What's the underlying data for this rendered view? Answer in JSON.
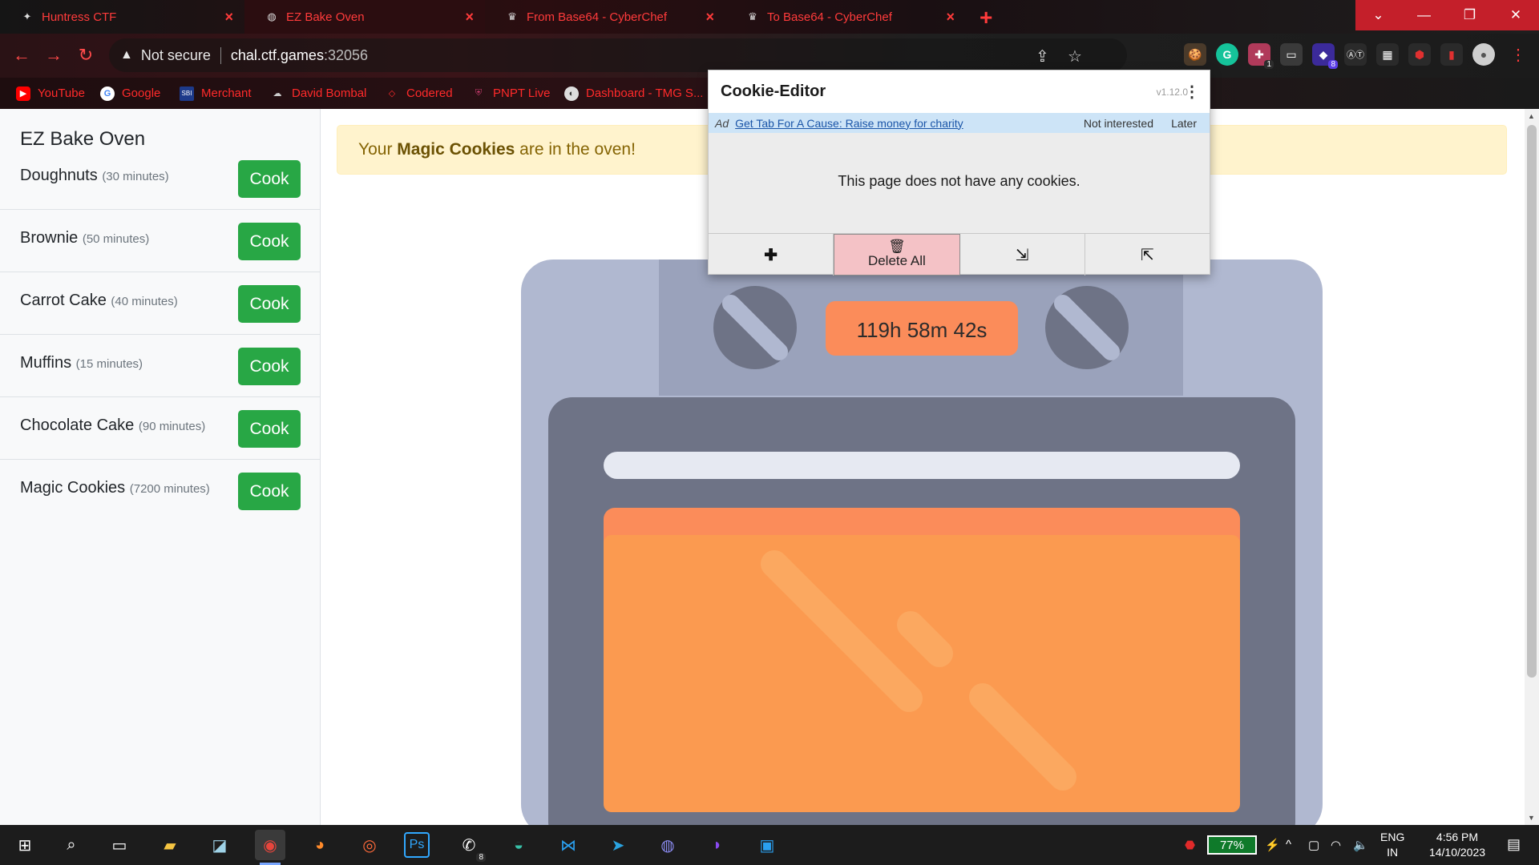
{
  "browser": {
    "tabs": [
      {
        "label": "Huntress CTF",
        "icon": "huntress-icon"
      },
      {
        "label": "EZ Bake Oven",
        "icon": "globe-icon"
      },
      {
        "label": "From Base64 - CyberChef",
        "icon": "chef-hat-icon"
      },
      {
        "label": "To Base64 - CyberChef",
        "icon": "chef-hat-icon"
      }
    ],
    "security_label": "Not secure",
    "url_host": "chal.ctf.games",
    "url_port": ":32056",
    "extension_badges": {
      "ext1": "1",
      "ext2": "8"
    },
    "bookmarks": [
      {
        "label": "YouTube",
        "icon": "youtube-icon",
        "color": "#ff0000"
      },
      {
        "label": "Google",
        "icon": "google-icon",
        "color": "#ffffff"
      },
      {
        "label": "Merchant",
        "icon": "merchant-icon",
        "color": "#1d3a8a"
      },
      {
        "label": "David Bombal",
        "icon": "david-bombal-icon",
        "color": "#cccccc"
      },
      {
        "label": "Codered",
        "icon": "codered-icon",
        "color": "#ff2a2a"
      },
      {
        "label": "PNPT Live",
        "icon": "pnpt-icon",
        "color": "#c23a6a"
      },
      {
        "label": "Dashboard - TMG S...",
        "icon": "dashboard-icon",
        "color": "#cccccc"
      }
    ]
  },
  "app": {
    "title": "EZ Bake Oven",
    "items": [
      {
        "name": "Doughnuts",
        "minutes": "(30 minutes)",
        "button": "Cook"
      },
      {
        "name": "Brownie",
        "minutes": "(50 minutes)",
        "button": "Cook"
      },
      {
        "name": "Carrot Cake",
        "minutes": "(40 minutes)",
        "button": "Cook"
      },
      {
        "name": "Muffins",
        "minutes": "(15 minutes)",
        "button": "Cook"
      },
      {
        "name": "Chocolate Cake",
        "minutes": "(90 minutes)",
        "button": "Cook"
      },
      {
        "name": "Magic Cookies",
        "minutes": "(7200 minutes)",
        "button": "Cook"
      }
    ],
    "alert": {
      "prefix": "Your ",
      "bold": "Magic Cookies",
      "suffix": " are in the oven!"
    },
    "timer": "119h 58m 42s"
  },
  "cookie_editor": {
    "title": "Cookie-Editor",
    "version": "v1.12.0",
    "ad_tag": "Ad",
    "ad_link": "Get Tab For A Cause: Raise money for charity",
    "ad_dismiss": "Not interested",
    "ad_later": "Later",
    "empty_message": "This page does not have any cookies.",
    "delete_all": "Delete All"
  },
  "taskbar": {
    "battery": "77%",
    "lang_line1": "ENG",
    "lang_line2": "IN",
    "time": "4:56 PM",
    "date": "14/10/2023",
    "whatsapp_badge": "8"
  },
  "colors": {
    "accent_red": "#ff3b3b",
    "cook_green": "#28a745",
    "alert_bg": "#fff3cd",
    "timer_orange": "#fb8c5a",
    "oven_body": "#b0b8d0",
    "oven_window": "#fb9a50"
  }
}
